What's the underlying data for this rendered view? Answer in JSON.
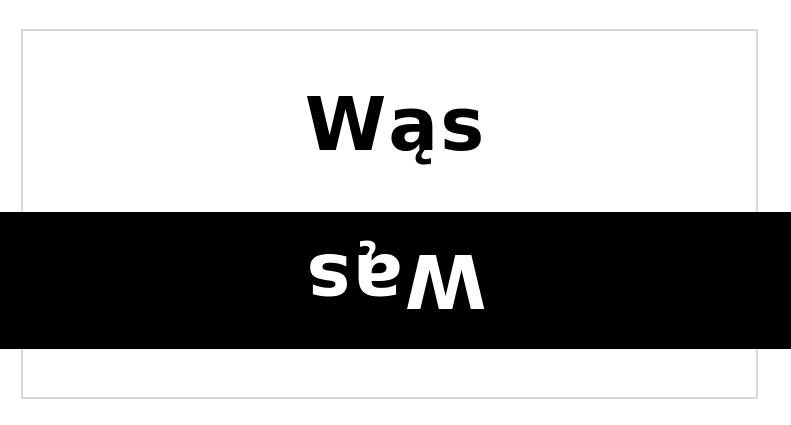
{
  "glyph_sample": {
    "text": "Wąs",
    "upright_color": "#000000",
    "band_color": "#000000",
    "flipped_color": "#ffffff",
    "frame_color": "#d8d8d8"
  }
}
